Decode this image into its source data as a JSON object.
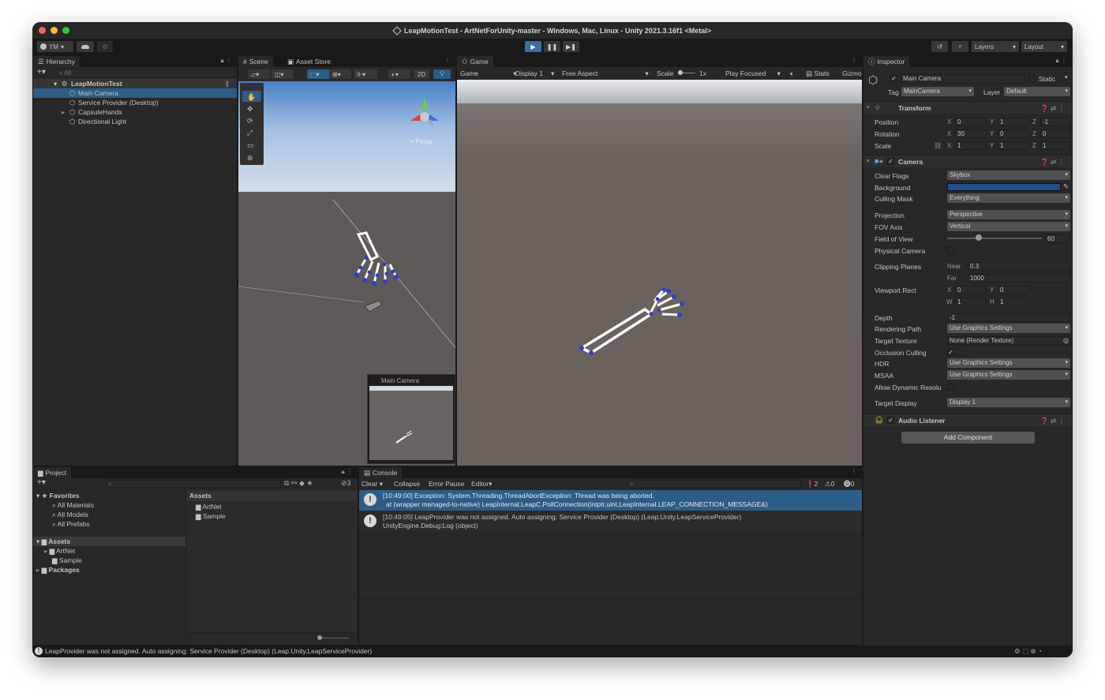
{
  "window": {
    "title": "LeapMotionTest - ArtNetForUnity-master - Windows, Mac, Linux - Unity 2021.3.16f1 <Metal>"
  },
  "toolbar": {
    "account": "YM",
    "layers": "Layers",
    "layout": "Layout"
  },
  "hierarchy": {
    "tab": "Hierarchy",
    "search_placeholder": "All",
    "scene": "LeapMotionTest",
    "items": [
      "Main Camera",
      "Service Provider (Desktop)",
      "CapsuleHands",
      "Directional Light"
    ]
  },
  "scene_view": {
    "tabs": [
      "Scene",
      "Asset Store"
    ],
    "mode_2d": "2D",
    "persp_label": "< Persp",
    "preview_title": "Main Camera"
  },
  "game_view": {
    "tab": "Game",
    "display_mode": "Game",
    "display": "Display 1",
    "aspect": "Free Aspect",
    "scale_label": "Scale",
    "scale_value": "1x",
    "play_focused": "Play Focused",
    "stats": "Stats",
    "gizmos": "Gizmo"
  },
  "inspector": {
    "tab": "Inspector",
    "object_name": "Main Camera",
    "static_label": "Static",
    "tag_label": "Tag",
    "tag_value": "MainCamera",
    "layer_label": "Layer",
    "layer_value": "Default",
    "transform": {
      "title": "Transform",
      "position_label": "Position",
      "rotation_label": "Rotation",
      "scale_label": "Scale",
      "position": {
        "x": "0",
        "y": "1",
        "z": "-1"
      },
      "rotation": {
        "x": "30",
        "y": "0",
        "z": "0"
      },
      "scale": {
        "x": "1",
        "y": "1",
        "z": "1"
      }
    },
    "camera": {
      "title": "Camera",
      "clear_flags_label": "Clear Flags",
      "clear_flags": "Skybox",
      "background_label": "Background",
      "background_color": "#1f4f8f",
      "culling_mask_label": "Culling Mask",
      "culling_mask": "Everything",
      "projection_label": "Projection",
      "projection": "Perspective",
      "fov_axis_label": "FOV Axis",
      "fov_axis": "Vertical",
      "fov_label": "Field of View",
      "fov_value": "60",
      "fov_fraction": 0.33,
      "physical_label": "Physical Camera",
      "clipping_label": "Clipping Planes",
      "near_label": "Near",
      "near": "0.3",
      "far_label": "Far",
      "far": "1000",
      "viewport_label": "Viewport Rect",
      "viewport": {
        "x": "0",
        "y": "0",
        "w": "1",
        "h": "1"
      },
      "depth_label": "Depth",
      "depth": "-1",
      "rendering_path_label": "Rendering Path",
      "rendering_path": "Use Graphics Settings",
      "target_texture_label": "Target Texture",
      "target_texture": "None (Render Texture)",
      "occlusion_label": "Occlusion Culling",
      "hdr_label": "HDR",
      "hdr": "Use Graphics Settings",
      "msaa_label": "MSAA",
      "msaa": "Use Graphics Settings",
      "dynamic_label": "Allow Dynamic Resolu",
      "target_display_label": "Target Display",
      "target_display": "Display 1"
    },
    "audio_listener": "Audio Listener",
    "add_component": "Add Component"
  },
  "project": {
    "tab": "Project",
    "badge": "3",
    "favorites_label": "Favorites",
    "favorites": [
      "All Materials",
      "All Models",
      "All Prefabs"
    ],
    "assets_label": "Assets",
    "assets_tree": [
      "ArtNet",
      "Sample"
    ],
    "packages_label": "Packages",
    "assets_header": "Assets",
    "assets_items": [
      "ArtNet",
      "Sample"
    ]
  },
  "console": {
    "tab": "Console",
    "clear": "Clear",
    "collapse": "Collapse",
    "error_pause": "Error Pause",
    "editor": "Editor",
    "count_info": "2",
    "count_warn": "0",
    "count_err": "0",
    "messages": [
      {
        "line1": "[10:49:00] Exception: System.Threading.ThreadAbortException: Thread was being aborted.",
        "line2": "at (wrapper managed-to-native) LeapInternal.LeapC.PollConnection(intptr,uint,LeapInternal.LEAP_CONNECTION_MESSAGE&)"
      },
      {
        "line1": "[10:49:05] LeapProvider was not assigned. Auto assigning: Service Provider (Desktop) (Leap.Unity.LeapServiceProvider)",
        "line2": "UnityEngine.Debug:Log (object)"
      }
    ]
  },
  "status_bar": {
    "message": "LeapProvider was not assigned. Auto assigning: Service Provider (Desktop) (Leap.Unity.LeapServiceProvider)"
  },
  "colors": {
    "accent": "#2c5d87",
    "play_active": "#3a6ea5",
    "selection": "#2c5d87"
  }
}
